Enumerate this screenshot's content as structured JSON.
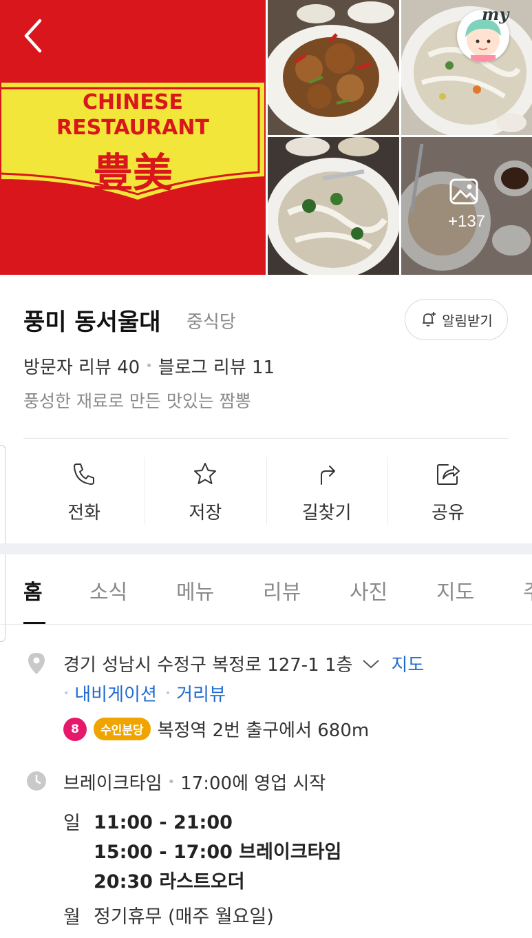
{
  "header": {
    "back_label": "back",
    "my_label": "my",
    "banner": {
      "line1": "CHINESE",
      "line2": "RESTAURANT",
      "line3": "豊美"
    },
    "photo_count": "+137"
  },
  "place": {
    "name": "풍미 동서울대",
    "category": "중식당",
    "notify_label": "알림받기",
    "visitor_reviews": "방문자 리뷰 40",
    "blog_reviews": "블로그 리뷰 11",
    "tagline": "풍성한 재료로 만든 맛있는 짬뽕"
  },
  "actions": [
    {
      "label": "전화",
      "icon": "phone-icon"
    },
    {
      "label": "저장",
      "icon": "star-icon"
    },
    {
      "label": "길찾기",
      "icon": "directions-icon"
    },
    {
      "label": "공유",
      "icon": "share-icon"
    }
  ],
  "tabs": [
    {
      "label": "홈",
      "active": true
    },
    {
      "label": "소식"
    },
    {
      "label": "메뉴"
    },
    {
      "label": "리뷰"
    },
    {
      "label": "사진"
    },
    {
      "label": "지도"
    },
    {
      "label": "주"
    }
  ],
  "info": {
    "address": "경기 성남시 수정구 복정로 127-1 1층",
    "map_link": "지도",
    "navigation_link": "내비게이션",
    "streetview_link": "거리뷰",
    "subway": {
      "line_number": "8",
      "line_name": "수인분당",
      "line_color": "#e6186c",
      "line_name_color": "#f0a400",
      "text": "복정역 2번 출구에서 680m"
    },
    "status": "브레이크타임",
    "status_detail": "17:00에 영업 시작",
    "hours": [
      {
        "day": "일",
        "lines": [
          "11:00 - 21:00",
          "15:00 - 17:00 브레이크타임",
          "20:30 라스트오더"
        ]
      },
      {
        "day": "월",
        "lines": [
          "정기휴무 (매주 월요일)"
        ]
      }
    ]
  },
  "colors": {
    "link": "#1f6bd1",
    "brand_red": "#d8161b",
    "brand_yellow": "#f6e734"
  }
}
